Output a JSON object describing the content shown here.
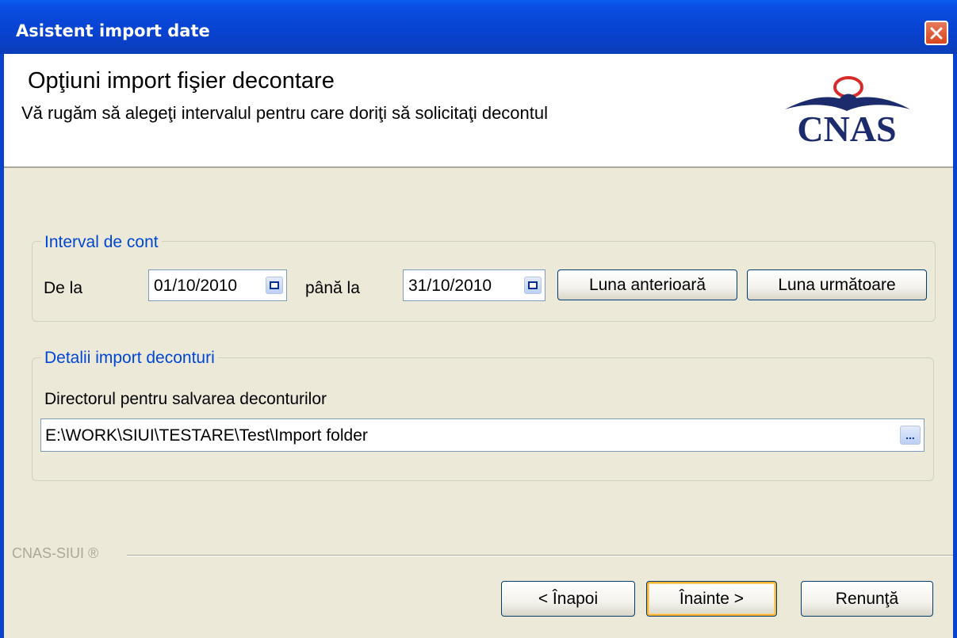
{
  "window": {
    "title": "Asistent import date",
    "close_icon": "close-icon"
  },
  "header": {
    "title": "Opţiuni import fişier decontare",
    "subtitle": "Vă rugăm să alegeţi intervalul pentru care doriţi să solicitaţi decontul",
    "logo_text": "CNAS"
  },
  "interval_group": {
    "legend": "Interval de cont",
    "from_label": "De la",
    "from_value": "01/10/2010",
    "to_label": "până la",
    "to_value": "31/10/2010",
    "prev_month_button": "Luna anterioară",
    "next_month_button": "Luna următoare"
  },
  "details_group": {
    "legend": "Detalii import deconturi",
    "directory_label": "Directorul pentru salvarea deconturilor",
    "directory_value": "E:\\WORK\\SIUI\\TESTARE\\Test\\Import folder",
    "browse_label": "..."
  },
  "footer": {
    "brand": "CNAS-SIUI ®",
    "back_button": "< Înapoi",
    "next_button": "Înainte >",
    "cancel_button": "Renunţă"
  },
  "colors": {
    "titlebar": "#0842cf",
    "group_legend": "#0046d5",
    "close_button": "#d9461f",
    "default_button_highlight": "#f8b32f",
    "logo_blue": "#1b2b6b",
    "logo_red": "#d82a2a"
  }
}
